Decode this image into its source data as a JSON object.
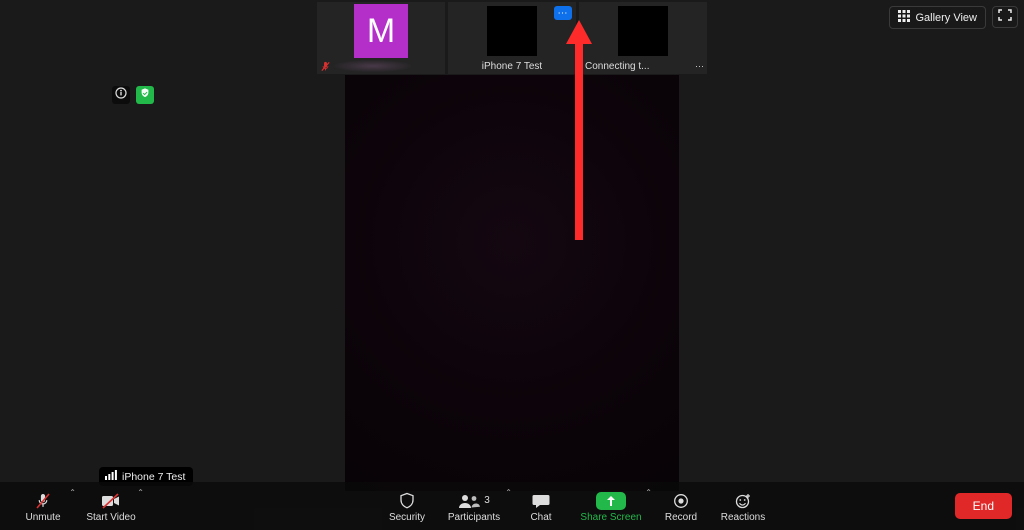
{
  "top_right": {
    "gallery_label": "Gallery View"
  },
  "thumbnails": [
    {
      "avatar_initial": "M"
    },
    {
      "label": "iPhone 7 Test"
    },
    {
      "label": "Connecting t...",
      "more_badge": "⋯"
    }
  ],
  "overlay": {
    "info_tooltip": "Meeting information"
  },
  "audio_source_tooltip": "iPhone 7 Test",
  "controls": {
    "unmute": "Unmute",
    "start_video": "Start Video",
    "security": "Security",
    "participants": "Participants",
    "participants_count": "3",
    "chat": "Chat",
    "share_screen": "Share Screen",
    "record": "Record",
    "reactions": "Reactions",
    "end": "End"
  },
  "colors": {
    "accent_green": "#23b84a",
    "accent_red": "#e02828",
    "accent_blue": "#0e71eb",
    "avatar_purple": "#b42fc9"
  }
}
